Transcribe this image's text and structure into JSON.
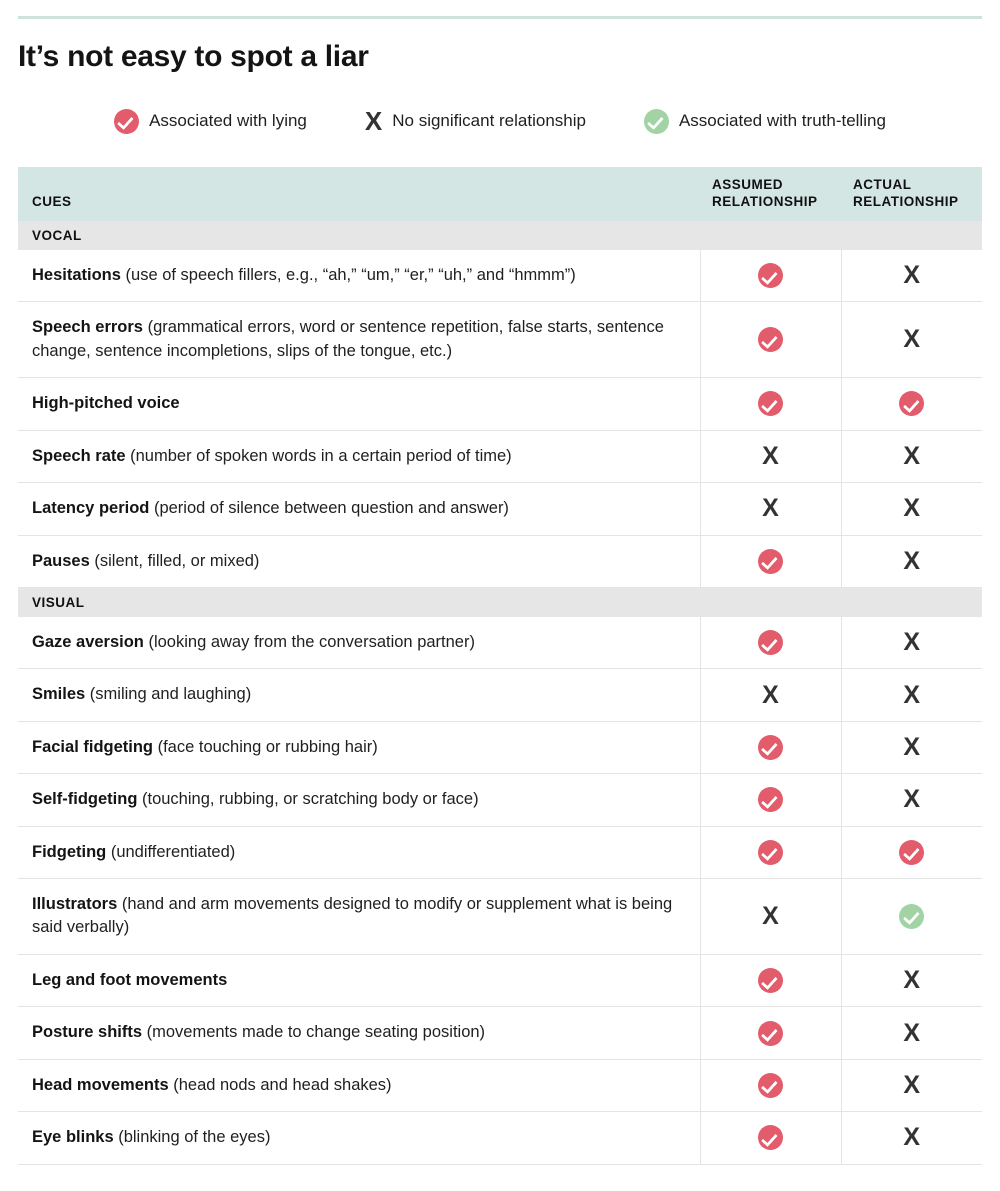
{
  "title": "It’s not easy to spot a liar",
  "colors": {
    "lying": "#e25c6b",
    "truth": "#a1d3a4",
    "no_relationship": "#333333",
    "header_band": "#d4e6e3",
    "section_band": "#e6e6e6",
    "top_rule": "#cfe3de"
  },
  "legend": [
    {
      "icon": "check-circle-red-icon",
      "mark": "red-check",
      "label": "Associated with lying"
    },
    {
      "icon": "x-mark-icon",
      "mark": "x",
      "label": "No significant relationship"
    },
    {
      "icon": "check-circle-green-icon",
      "mark": "green-check",
      "label": "Associated with truth-telling"
    }
  ],
  "table": {
    "headers": {
      "cues": "CUES",
      "assumed": "ASSUMED\nRELATIONSHIP",
      "assumed_line1": "ASSUMED",
      "assumed_line2": "RELATIONSHIP",
      "actual_line1": "ACTUAL",
      "actual_line2": "RELATIONSHIP"
    },
    "sections": [
      {
        "label": "VOCAL",
        "rows": [
          {
            "name": "Hesitations",
            "detail": " (use of speech fillers, e.g., “ah,” “um,” “er,” “uh,” and “hmmm”)",
            "assumed": "red-check",
            "actual": "x"
          },
          {
            "name": "Speech errors",
            "detail": " (grammatical errors, word or sentence repetition, false starts, sentence change, sentence incompletions, slips of the tongue, etc.)",
            "assumed": "red-check",
            "actual": "x"
          },
          {
            "name": "High-pitched voice",
            "detail": "",
            "assumed": "red-check",
            "actual": "red-check"
          },
          {
            "name": "Speech rate",
            "detail": " (number of spoken words in a certain period of time)",
            "assumed": "x",
            "actual": "x"
          },
          {
            "name": "Latency period",
            "detail": " (period of silence between question and answer)",
            "assumed": "x",
            "actual": "x"
          },
          {
            "name": "Pauses",
            "detail": " (silent, filled, or mixed)",
            "assumed": "red-check",
            "actual": "x"
          }
        ]
      },
      {
        "label": "VISUAL",
        "rows": [
          {
            "name": "Gaze aversion",
            "detail": " (looking away from the conversation partner)",
            "assumed": "red-check",
            "actual": "x"
          },
          {
            "name": "Smiles",
            "detail": " (smiling and laughing)",
            "assumed": "x",
            "actual": "x"
          },
          {
            "name": "Facial fidgeting",
            "detail": " (face touching or rubbing hair)",
            "assumed": "red-check",
            "actual": "x"
          },
          {
            "name": "Self-fidgeting",
            "detail": " (touching, rubbing, or scratching body or face)",
            "assumed": "red-check",
            "actual": "x"
          },
          {
            "name": "Fidgeting",
            "detail": " (undifferentiated)",
            "assumed": "red-check",
            "actual": "red-check"
          },
          {
            "name": "Illustrators",
            "detail": " (hand and arm movements designed to modify or supplement what is being said verbally)",
            "assumed": "x",
            "actual": "green-check"
          },
          {
            "name": "Leg and foot movements",
            "detail": "",
            "assumed": "red-check",
            "actual": "x"
          },
          {
            "name": "Posture shifts",
            "detail": " (movements made to change seating position)",
            "assumed": "red-check",
            "actual": "x"
          },
          {
            "name": "Head movements",
            "detail": " (head nods and head shakes)",
            "assumed": "red-check",
            "actual": "x"
          },
          {
            "name": "Eye blinks",
            "detail": " (blinking of the eyes)",
            "assumed": "red-check",
            "actual": "x"
          }
        ]
      }
    ]
  }
}
